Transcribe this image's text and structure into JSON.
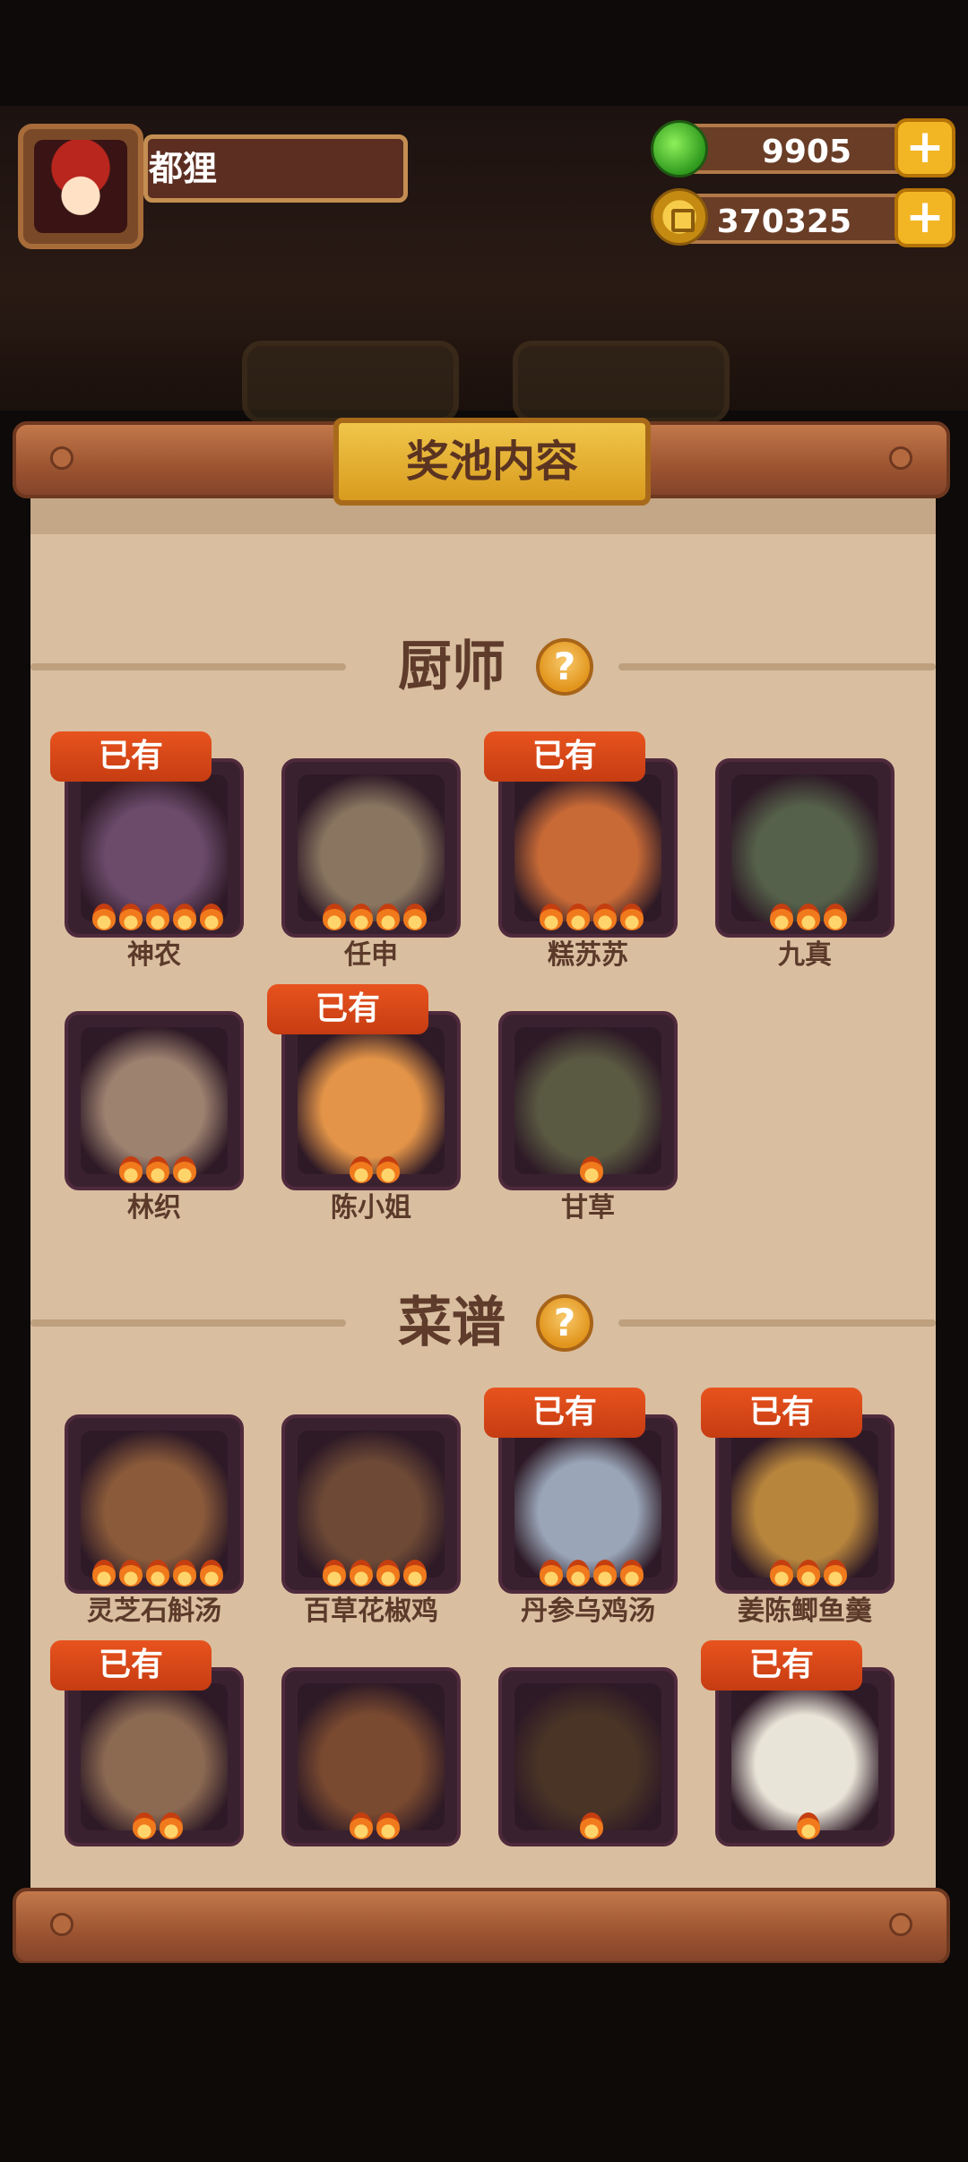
{
  "player": {
    "name": "都狸"
  },
  "currencies": {
    "gems": "9905",
    "coins": "370325",
    "add_symbol": "+"
  },
  "panel": {
    "title": "奖池内容"
  },
  "sections": [
    {
      "title": "厨师",
      "help_symbol": "?",
      "items": [
        {
          "name": "神农",
          "owned": true,
          "stars": 5,
          "art": "#6b4a6a"
        },
        {
          "name": "任申",
          "owned": false,
          "stars": 4,
          "art": "#8a7660"
        },
        {
          "name": "糕苏苏",
          "owned": true,
          "stars": 4,
          "art": "#c86a36"
        },
        {
          "name": "九真",
          "owned": false,
          "stars": 3,
          "art": "#55614a"
        },
        {
          "name": "林织",
          "owned": false,
          "stars": 3,
          "art": "#9e8270"
        },
        {
          "name": "陈小姐",
          "owned": true,
          "stars": 2,
          "art": "#e39448"
        },
        {
          "name": "甘草",
          "owned": false,
          "stars": 1,
          "art": "#5a5a42"
        }
      ]
    },
    {
      "title": "菜谱",
      "help_symbol": "?",
      "items": [
        {
          "name": "灵芝石斛汤",
          "owned": false,
          "stars": 5,
          "art": "#8a5a3a"
        },
        {
          "name": "百草花椒鸡",
          "owned": false,
          "stars": 4,
          "art": "#6e4a36"
        },
        {
          "name": "丹参乌鸡汤",
          "owned": true,
          "stars": 4,
          "art": "#9aa6b8"
        },
        {
          "name": "姜陈鲫鱼羹",
          "owned": true,
          "stars": 3,
          "art": "#b8853c"
        },
        {
          "name": "",
          "owned": true,
          "stars": 2,
          "art": "#8c6a52"
        },
        {
          "name": "",
          "owned": false,
          "stars": 2,
          "art": "#7a4a30"
        },
        {
          "name": "",
          "owned": false,
          "stars": 1,
          "art": "#4a3426"
        },
        {
          "name": "",
          "owned": true,
          "stars": 1,
          "art": "#e9e4d8"
        }
      ]
    }
  ],
  "labels": {
    "owned_badge": "已有"
  }
}
